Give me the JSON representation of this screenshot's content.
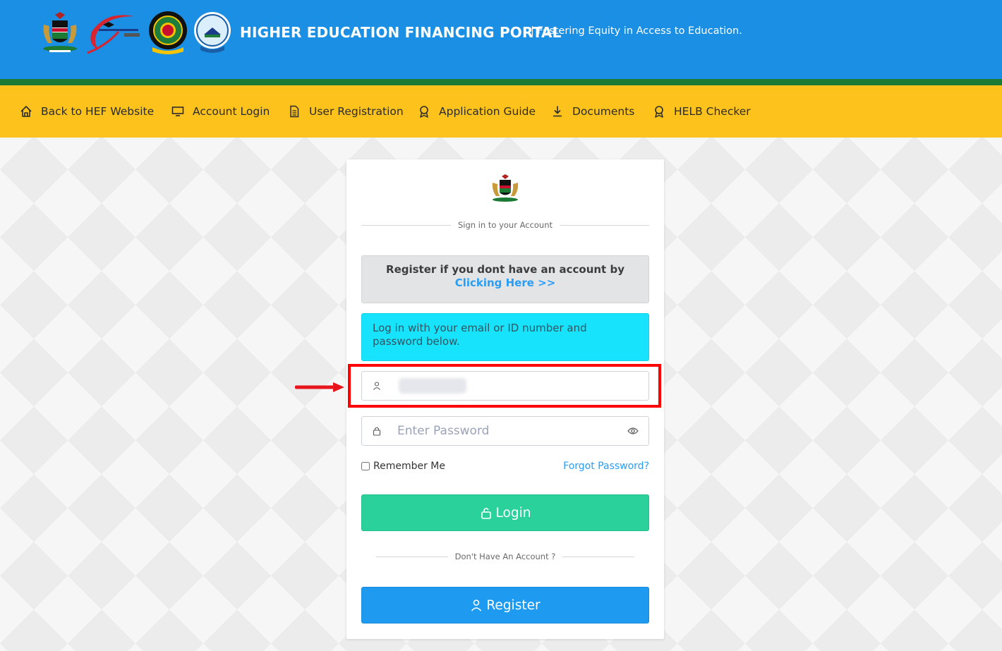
{
  "header": {
    "title": "HIGHER EDUCATION FINANCING PORTAL",
    "tagline": "| Fostering Equity in Access to Education.",
    "colors": {
      "header_bg": "#1a8fe3",
      "stripe": "#1b7a33",
      "nav_bg": "#fdc31c"
    },
    "logos": [
      "kenya-coat-of-arms",
      "hef-logo",
      "helb-logo",
      "universities-fund-logo"
    ]
  },
  "nav": {
    "items": [
      {
        "label": "Back to HEF Website",
        "icon": "home-icon"
      },
      {
        "label": "Account Login",
        "icon": "monitor-icon"
      },
      {
        "label": "User Registration",
        "icon": "document-icon"
      },
      {
        "label": "Application Guide",
        "icon": "award-icon"
      },
      {
        "label": "Documents",
        "icon": "download-icon"
      },
      {
        "label": "HELB Checker",
        "icon": "award-icon"
      }
    ]
  },
  "login": {
    "signin_caption": "Sign in to your Account",
    "register_alert_text": "Register if you dont have an account by ",
    "register_alert_link": "Clicking Here >>",
    "info_text": "Log in with your email or ID number and password below.",
    "username_value": "",
    "password_placeholder": "Enter Password",
    "remember_label": "Remember Me",
    "forgot_label": "Forgot Password?",
    "login_button": "Login",
    "no_account_caption": "Don't Have An Account ?",
    "register_button": "Register",
    "colors": {
      "login": "#2ad19a",
      "register": "#1e9bf0",
      "info": "#17e4fc",
      "link": "#2a9df4"
    }
  },
  "annotation": {
    "color": "#ff0000",
    "target": "username-field"
  }
}
